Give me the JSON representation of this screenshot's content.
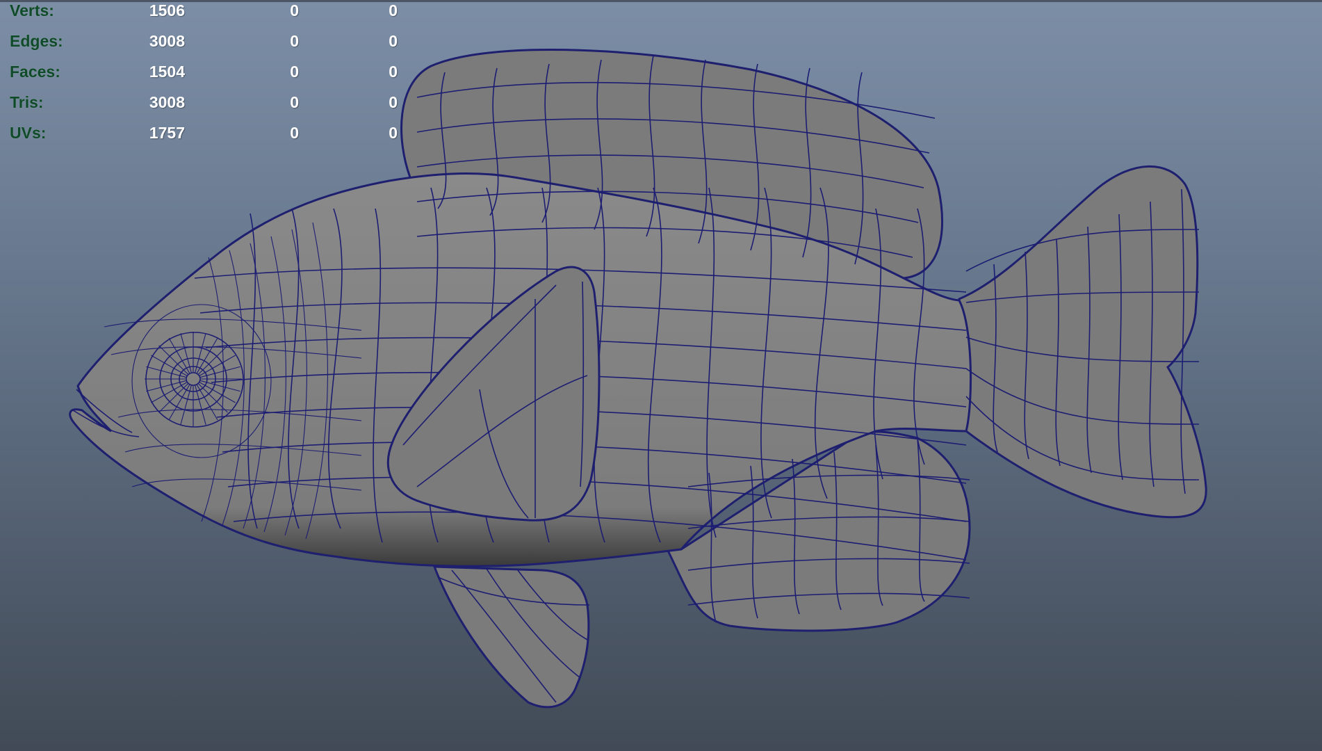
{
  "viewport": {
    "background_top": "#7c8ea6",
    "background_bottom": "#414a56",
    "wireframe_color": "#1c1d72",
    "mesh_fill": "#7f7f7f",
    "label_color": "#0f4a2a"
  },
  "poly_count": {
    "rows": [
      {
        "label": "Verts:",
        "object": "1506",
        "selected": "0",
        "component": "0"
      },
      {
        "label": "Edges:",
        "object": "3008",
        "selected": "0",
        "component": "0"
      },
      {
        "label": "Faces:",
        "object": "1504",
        "selected": "0",
        "component": "0"
      },
      {
        "label": "Tris:",
        "object": "3008",
        "selected": "0",
        "component": "0"
      },
      {
        "label": "UVs:",
        "object": "1757",
        "selected": "0",
        "component": "0"
      }
    ]
  }
}
